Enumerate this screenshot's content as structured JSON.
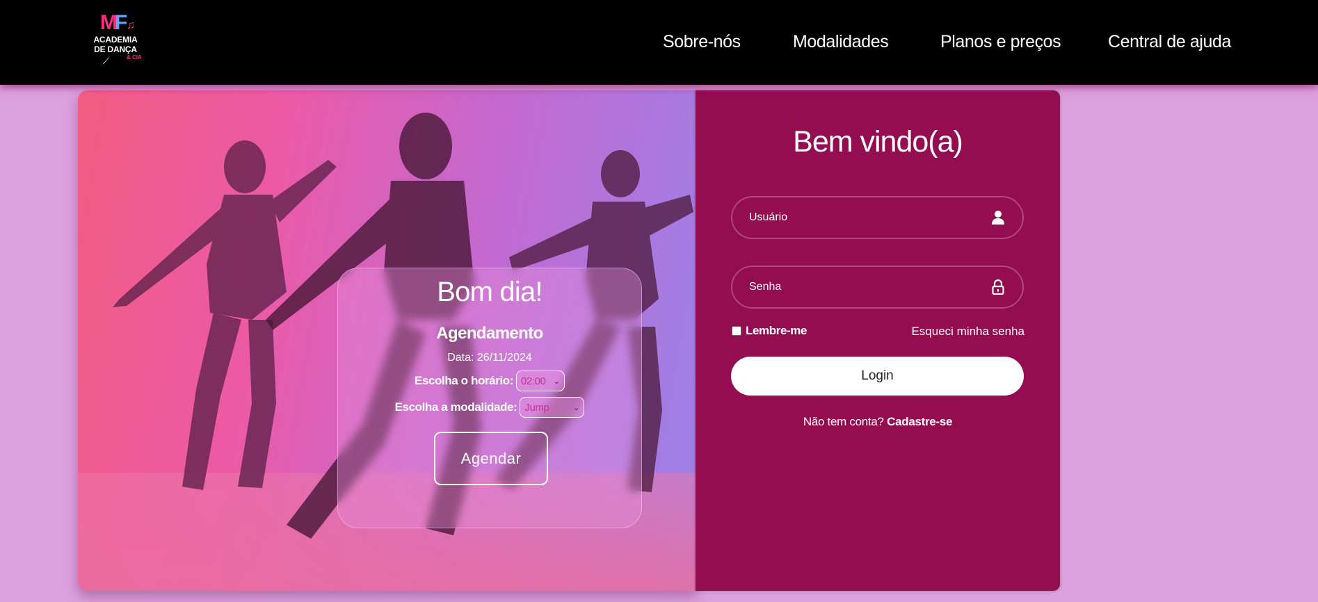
{
  "header": {
    "logo": {
      "mark_m": "M",
      "mark_f": "F",
      "line1": "ACADEMIA",
      "line2": "DE DANÇA",
      "cia": "& CIA"
    },
    "nav": [
      "Sobre-nós",
      "Modalidades",
      "Planos e preços",
      "Central de ajuda"
    ]
  },
  "booking": {
    "greeting": "Bom dia!",
    "heading": "Agendamento",
    "date_text": "Data: 26/11/2024",
    "time_label": "Escolha o horário:",
    "time_value": "02:00",
    "modality_label": "Escolha a modalidade:",
    "modality_value": "Jump",
    "submit_label": "Agendar"
  },
  "login": {
    "title": "Bem vindo(a)",
    "username_placeholder": "Usuário",
    "password_placeholder": "Senha",
    "remember_label": "Lembre-me",
    "forgot_label": "Esqueci minha senha",
    "button_label": "Login",
    "signup_prompt": "Não tem conta?",
    "signup_link": "Cadastre-se"
  },
  "colors": {
    "page_bg": "#dca0dc",
    "header_bg": "#000000",
    "login_bg": "#940d50",
    "accent_pink": "#ff2e7e"
  },
  "icons": {
    "username": "user-icon",
    "password": "lock-icon",
    "select": "chevron-down-icon"
  }
}
